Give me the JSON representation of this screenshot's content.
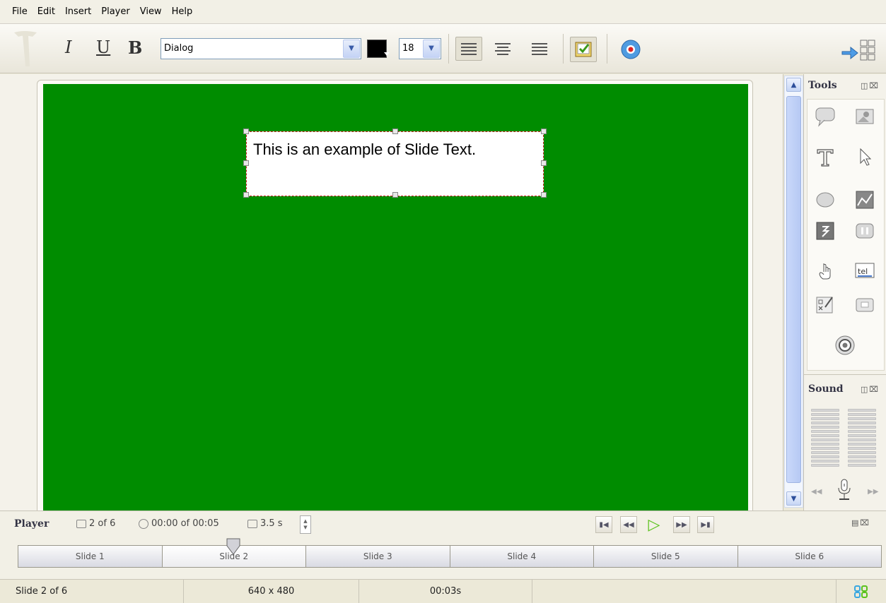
{
  "menu": [
    "File",
    "Edit",
    "Insert",
    "Player",
    "View",
    "Help"
  ],
  "toolbar": {
    "italic": "I",
    "underline": "U",
    "bold": "B",
    "font": "Dialog",
    "font_size": "18",
    "text_color": "#000000"
  },
  "slide": {
    "background": "#008c00",
    "text": "This is an example of Slide Text."
  },
  "panels": {
    "tools_title": "Tools",
    "sound_title": "Sound"
  },
  "player": {
    "label": "Player",
    "slide_pos": "2 of 6",
    "time": "00:00 of 00:05",
    "duration": "3.5 s"
  },
  "slides": [
    "Slide 1",
    "Slide 2",
    "Slide 3",
    "Slide 4",
    "Slide 5",
    "Slide 6"
  ],
  "active_slide_index": 1,
  "status": {
    "slide": "Slide 2 of 6",
    "size": "640 x 480",
    "time": "00:03s"
  },
  "colors": {
    "accent": "#5bc21d",
    "selection_border": "#cc2222"
  }
}
